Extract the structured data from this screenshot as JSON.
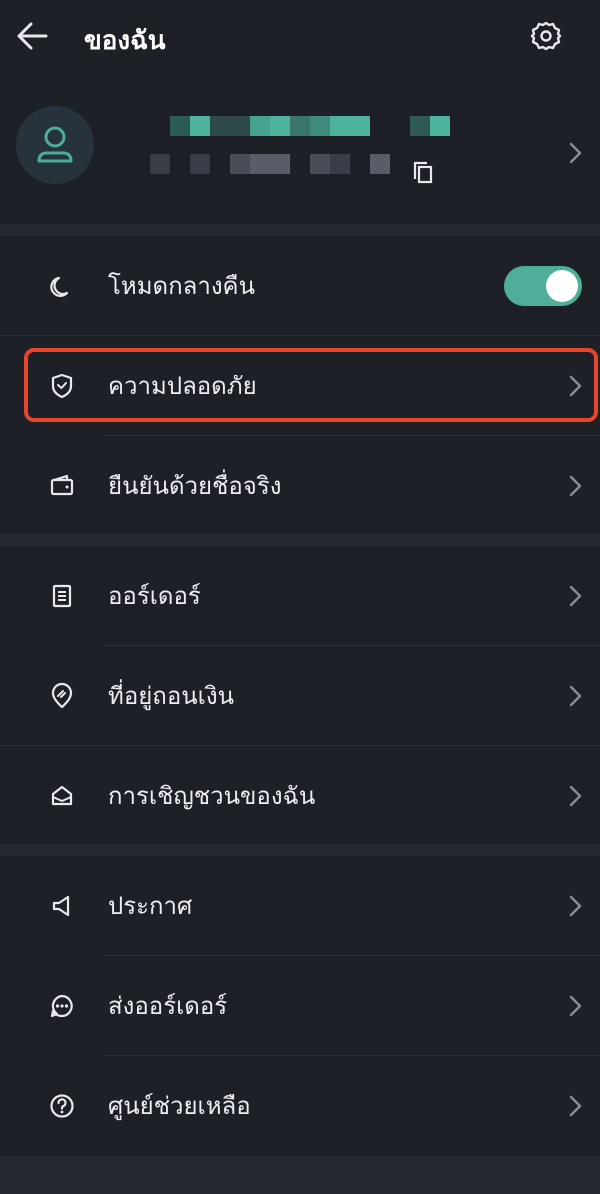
{
  "header": {
    "title": "ของฉัน",
    "back_icon": "arrow-left-icon",
    "settings_icon": "gear-icon"
  },
  "profile": {
    "avatar_icon": "user-icon",
    "copy_icon": "copy-icon",
    "chevron_icon": "chevron-right-icon",
    "accent_color": "#4eae99"
  },
  "menu": {
    "night_mode": {
      "label": "โหมดกลางคืน",
      "icon": "moon-icon",
      "enabled": true
    },
    "security": {
      "label": "ความปลอดภัย",
      "icon": "shield-icon"
    },
    "verification": {
      "label": "ยืนยันด้วยชื่อจริง",
      "icon": "wallet-icon"
    },
    "orders": {
      "label": "ออร์เดอร์",
      "icon": "document-icon"
    },
    "withdraw_address": {
      "label": "ที่อยู่ถอนเงิน",
      "icon": "location-pin-icon"
    },
    "invitations": {
      "label": "การเชิญชวนของฉัน",
      "icon": "mail-icon"
    },
    "announcements": {
      "label": "ประกาศ",
      "icon": "megaphone-icon"
    },
    "submit_order": {
      "label": "ส่งออร์เดอร์",
      "icon": "chat-bubble-icon"
    },
    "help_center": {
      "label": "ศูนย์ช่วยเหลือ",
      "icon": "help-circle-icon"
    }
  },
  "colors": {
    "background": "#1e2028",
    "separator": "#252830",
    "highlight_border": "#e8452b",
    "toggle_on": "#4eae99"
  }
}
